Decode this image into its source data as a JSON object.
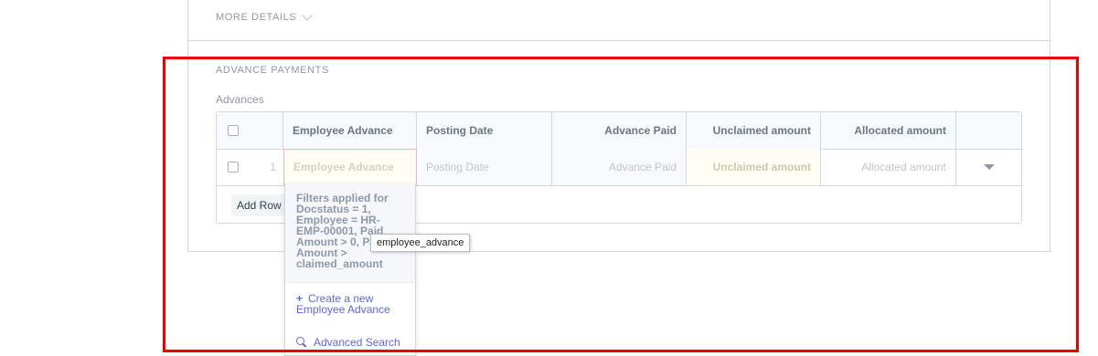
{
  "more_details": {
    "label": "MORE DETAILS"
  },
  "section": {
    "title": "ADVANCE PAYMENTS"
  },
  "field": {
    "label": "Advances"
  },
  "grid": {
    "columns": [
      "Employee Advance",
      "Posting Date",
      "Advance Paid",
      "Unclaimed amount",
      "Allocated amount"
    ],
    "rows": [
      {
        "index": "1",
        "employee_advance_placeholder": "Employee Advance",
        "posting_date_placeholder": "Posting Date",
        "advance_paid_placeholder": "Advance Paid",
        "unclaimed_amount_placeholder": "Unclaimed amount",
        "allocated_amount_placeholder": "Allocated amount"
      }
    ],
    "add_row_label": "Add Row"
  },
  "dropdown": {
    "filter_info": "Filters applied for Docstatus = 1, Employee = HR-EMP-00001, Paid Amount > 0, Paid Amount > claimed_amount",
    "create_new_label": "Create a new Employee Advance",
    "advanced_search_label": "Advanced Search"
  },
  "tooltip": {
    "text": "employee_advance"
  },
  "colors": {
    "highlight": "#ee0000",
    "link": "#5e64ff"
  }
}
